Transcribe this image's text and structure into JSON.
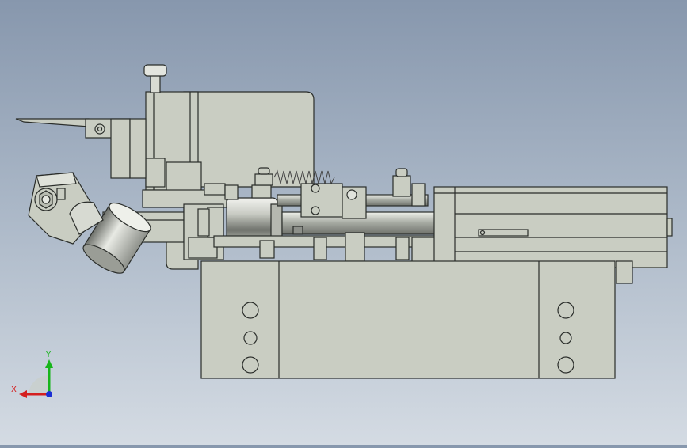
{
  "viewport": {
    "background_top": "#8797ad",
    "background_bottom": "#d4dbe3",
    "part_fill": "#c9cdc2",
    "part_stroke": "#2a2d2a"
  },
  "triad": {
    "x_label": "X",
    "y_label": "Y",
    "x_color": "#d41f1f",
    "y_color": "#17b51a",
    "z_color": "#1b2fd4"
  }
}
